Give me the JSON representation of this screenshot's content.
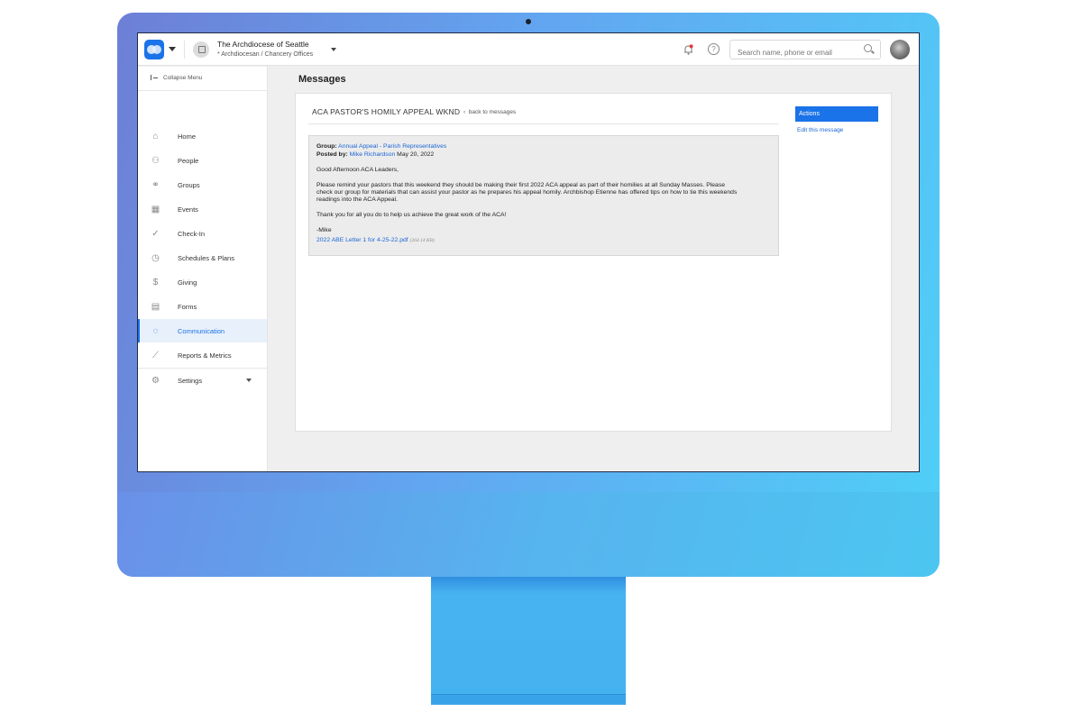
{
  "header": {
    "org_name": "The Archdiocese of Seattle",
    "org_sub": "* Archdiocesan / Chancery Offices",
    "search_placeholder": "Search name, phone or email"
  },
  "sidebar": {
    "collapse_label": "Collapse Menu",
    "items": [
      {
        "label": "Home",
        "icon": "home-icon",
        "glyph": "⌂"
      },
      {
        "label": "People",
        "icon": "people-icon",
        "glyph": "⚇"
      },
      {
        "label": "Groups",
        "icon": "groups-icon",
        "glyph": "⚭"
      },
      {
        "label": "Events",
        "icon": "calendar-icon",
        "glyph": "▦"
      },
      {
        "label": "Check-In",
        "icon": "check-circle-icon",
        "glyph": "✓"
      },
      {
        "label": "Schedules & Plans",
        "icon": "clock-icon",
        "glyph": "◷"
      },
      {
        "label": "Giving",
        "icon": "dollar-icon",
        "glyph": "$"
      },
      {
        "label": "Forms",
        "icon": "clipboard-icon",
        "glyph": "▤"
      },
      {
        "label": "Communication",
        "icon": "chat-icon",
        "glyph": "◌"
      },
      {
        "label": "Reports & Metrics",
        "icon": "metrics-icon",
        "glyph": "⟋"
      },
      {
        "label": "Settings",
        "icon": "gear-icon",
        "glyph": "⚙"
      }
    ],
    "active": "Communication"
  },
  "main": {
    "page_title": "Messages",
    "message": {
      "title": "ACA PASTOR'S HOMILY APPEAL WKND",
      "back_label": "back to messages",
      "group_label": "Group:",
      "group_value": "Annual Appeal - Parish Representatives",
      "posted_label": "Posted by:",
      "posted_by": "Mike Richardson",
      "posted_date": "May 20, 2022",
      "greeting": "Good Afternoon ACA Leaders,",
      "body_line1": "Please remind your pastors that this weekend they should be making their first 2022 ACA appeal as part of their homilies at all Sunday Masses. Please",
      "body_line2": "check our group for materials that can assist your pastor as he prepares his appeal homily. Archbishop Etienne has offered tips on how to tie this weekends",
      "body_line3": "readings into the ACA Appeal.",
      "thanks": "Thank you for all you do to help us achieve the great work of the ACA!",
      "signoff": "-Mike",
      "attachment_name": "2022 ABE Letter 1 for 4-25-22.pdf",
      "attachment_size": "(264.14 KB)"
    },
    "actions": {
      "heading": "Actions",
      "edit_label": "Edit this message"
    }
  },
  "colors": {
    "accent": "#1a73e8",
    "notification_dot": "#e53935"
  }
}
